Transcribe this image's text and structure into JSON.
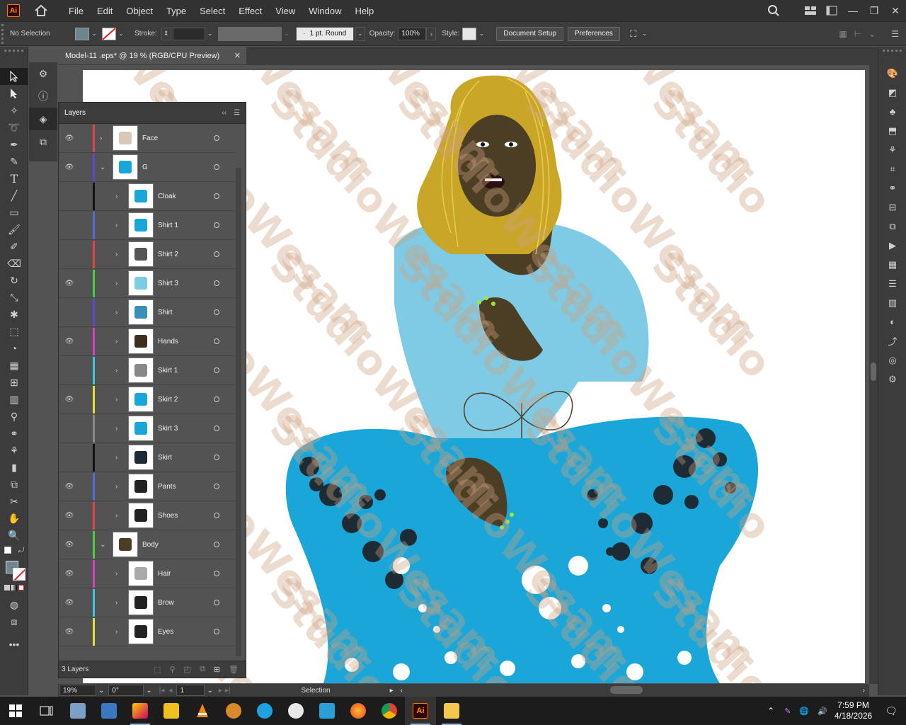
{
  "app": {
    "logo": "Ai",
    "menu": [
      "File",
      "Edit",
      "Object",
      "Type",
      "Select",
      "Effect",
      "View",
      "Window",
      "Help"
    ]
  },
  "control": {
    "selection": "No Selection",
    "stroke_label": "Stroke:",
    "brush": "1 pt. Round",
    "opacity_label": "Opacity:",
    "opacity": "100%",
    "style_label": "Style:",
    "document_setup": "Document Setup",
    "preferences": "Preferences"
  },
  "document": {
    "tab_title": "Model-11 .eps* @ 19 % (RGB/CPU Preview)"
  },
  "layers_panel": {
    "title": "Layers",
    "footer": "3 Layers",
    "rows": [
      {
        "name": "Face",
        "visible": true,
        "color": "#e0464a",
        "expanded": false,
        "depth": 0
      },
      {
        "name": "G",
        "visible": true,
        "color": "#5a4bd1",
        "expanded": true,
        "depth": 0
      },
      {
        "name": "Cloak",
        "visible": false,
        "color": "#111111",
        "depth": 1
      },
      {
        "name": "Shirt 1",
        "visible": false,
        "color": "#4f6fd6",
        "depth": 1
      },
      {
        "name": "Shirt 2",
        "visible": false,
        "color": "#e0464a",
        "depth": 1
      },
      {
        "name": "Shirt 3",
        "visible": true,
        "color": "#4ccd3c",
        "depth": 1
      },
      {
        "name": "Shirt",
        "visible": false,
        "color": "#5a4bd1",
        "depth": 1
      },
      {
        "name": "Hands",
        "visible": true,
        "color": "#d542c4",
        "depth": 1
      },
      {
        "name": "Skirt 1",
        "visible": false,
        "color": "#3ec9e0",
        "depth": 1
      },
      {
        "name": "Skirt 2",
        "visible": true,
        "color": "#e8e03a",
        "depth": 1
      },
      {
        "name": "Skirt 3",
        "visible": false,
        "color": "#888888",
        "depth": 1
      },
      {
        "name": "Skirt",
        "visible": false,
        "color": "#111111",
        "depth": 1
      },
      {
        "name": "Pants",
        "visible": true,
        "color": "#4f6fd6",
        "depth": 1
      },
      {
        "name": "Shoes",
        "visible": true,
        "color": "#e0464a",
        "depth": 1
      },
      {
        "name": "Body",
        "visible": true,
        "color": "#4ccd3c",
        "expanded": true,
        "depth": 0
      },
      {
        "name": "Hair",
        "visible": true,
        "color": "#d542c4",
        "depth": 1
      },
      {
        "name": "Brow",
        "visible": true,
        "color": "#3ec9e0",
        "depth": 1
      },
      {
        "name": "Eyes",
        "visible": true,
        "color": "#e8e03a",
        "depth": 1
      }
    ]
  },
  "status": {
    "zoom": "19%",
    "rotate": "0°",
    "artboard": "1",
    "tool": "Selection"
  },
  "watermark": [
    "Wesam",
    "Studio"
  ],
  "taskbar": {
    "time": "7:59 PM",
    "date": "4/18/2026"
  }
}
